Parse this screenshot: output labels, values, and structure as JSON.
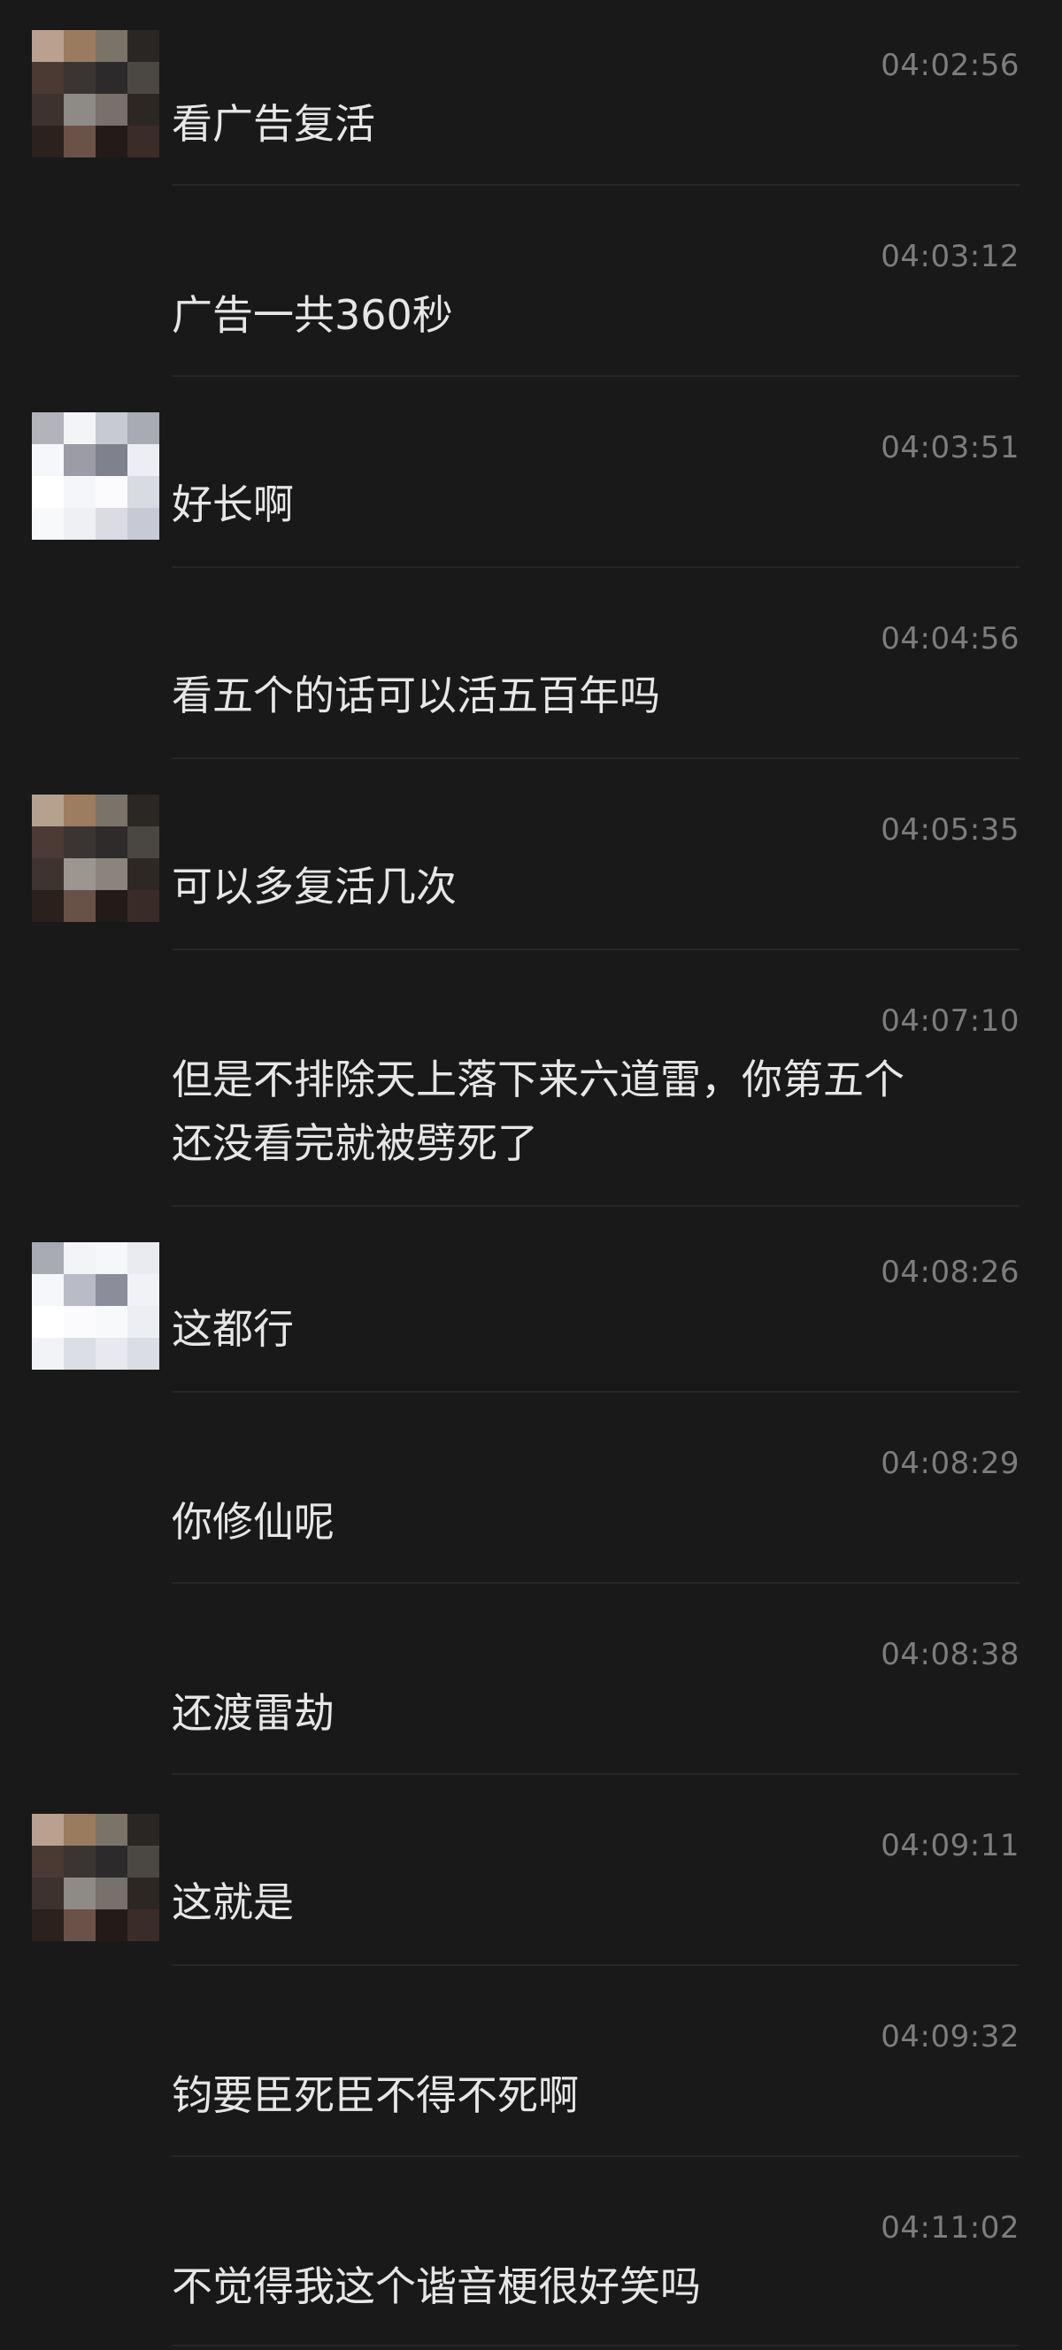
{
  "colors": {
    "background": "#191919",
    "text": "#e6e6e6",
    "timestamp": "#7d7d7d",
    "divider": "#262626"
  },
  "messages": [
    {
      "time": "04:02:56",
      "text": "看广告复活",
      "avatar": "dark"
    },
    {
      "time": "04:03:12",
      "text": "广告一共360秒"
    },
    {
      "time": "04:03:51",
      "text": "好长啊",
      "avatar": "light"
    },
    {
      "time": "04:04:56",
      "text": "看五个的话可以活五百年吗"
    },
    {
      "time": "04:05:35",
      "text": "可以多复活几次",
      "avatar": "dark"
    },
    {
      "time": "04:07:10",
      "text": "但是不排除天上落下来六道雷，你第五个\n还没看完就被劈死了"
    },
    {
      "time": "04:08:26",
      "text": "这都行",
      "avatar": "light"
    },
    {
      "time": "04:08:29",
      "text": "你修仙呢"
    },
    {
      "time": "04:08:38",
      "text": "还渡雷劫"
    },
    {
      "time": "04:09:11",
      "text": "这就是",
      "avatar": "dark"
    },
    {
      "time": "04:09:32",
      "text": "钧要臣死臣不得不死啊"
    },
    {
      "time": "04:11:02",
      "text": "不觉得我这个谐音梗很好笑吗"
    }
  ]
}
